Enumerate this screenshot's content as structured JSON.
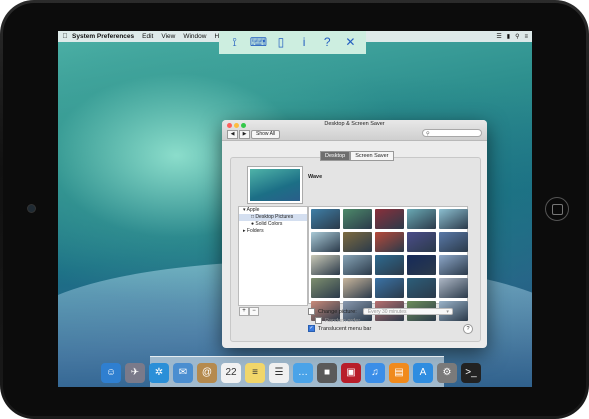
{
  "menubar": {
    "apple_symbol": "",
    "app_name": "System Preferences",
    "items": [
      "Edit",
      "View",
      "Window",
      "Help"
    ]
  },
  "toolbar": {
    "icons": [
      {
        "name": "pin-icon",
        "glyph": "⟟"
      },
      {
        "name": "keyboard-icon",
        "glyph": "⌨"
      },
      {
        "name": "mouse-icon",
        "glyph": "▯"
      },
      {
        "name": "info-icon",
        "glyph": "i"
      },
      {
        "name": "help-icon",
        "glyph": "?"
      },
      {
        "name": "close-icon",
        "glyph": "✕"
      }
    ]
  },
  "window": {
    "title": "Desktop & Screen Saver",
    "nav_back": "◀",
    "nav_forward": "▶",
    "show_all": "Show All",
    "search_placeholder": "",
    "tabs": [
      "Desktop",
      "Screen Saver"
    ],
    "active_tab": "Desktop",
    "current_picture_name": "Wave",
    "sidebar": {
      "group": "Apple",
      "items": [
        "Desktop Pictures",
        "Solid Colors"
      ],
      "selected": "Desktop Pictures",
      "folders": "Folders"
    },
    "add_label": "+",
    "remove_label": "−",
    "change_picture_label": "Change picture:",
    "change_picture_interval": "Every 30 minutes",
    "random_order_label": "Random order",
    "translucent_label": "Translucent menu bar",
    "help_label": "?"
  },
  "thumbnails": [
    "#3f7fa7",
    "#4d8a6a",
    "#8a2f3a",
    "#6aa9b4",
    "#8cbfd0",
    "#a9c9d6",
    "#7d6b40",
    "#b64a3a",
    "#4b4d8a",
    "#5a79a8",
    "#c9c9b7",
    "#87a4b6",
    "#2e6a8f",
    "#162a5a",
    "#8da7c8",
    "#7e8f6f",
    "#c9b69c",
    "#3b73a6",
    "#2c5e7a",
    "#aeb8c6",
    "#c98a7a",
    "#8a9ab0",
    "#b86f6f",
    "#6c8d5a",
    "#9ab3c9"
  ],
  "dock": {
    "icons": [
      {
        "name": "finder-icon",
        "color": "#2f7fd0",
        "glyph": "☺"
      },
      {
        "name": "launchpad-icon",
        "color": "#7a7a8a",
        "glyph": "✈"
      },
      {
        "name": "safari-icon",
        "color": "#2a8fd8",
        "glyph": "✲"
      },
      {
        "name": "mail-icon",
        "color": "#4b8ed0",
        "glyph": "✉"
      },
      {
        "name": "contacts-icon",
        "color": "#b58a4e",
        "glyph": "@"
      },
      {
        "name": "calendar-icon",
        "color": "#f2f2f2",
        "glyph": "22"
      },
      {
        "name": "notes-icon",
        "color": "#f1d66a",
        "glyph": "≡"
      },
      {
        "name": "reminders-icon",
        "color": "#f0f0f0",
        "glyph": "☰"
      },
      {
        "name": "messages-icon",
        "color": "#4aa3e8",
        "glyph": "…"
      },
      {
        "name": "facetime-icon",
        "color": "#5a5a5a",
        "glyph": "■"
      },
      {
        "name": "photo-booth-icon",
        "color": "#b81e2a",
        "glyph": "▣"
      },
      {
        "name": "itunes-icon",
        "color": "#3b8ee8",
        "glyph": "♫"
      },
      {
        "name": "ibooks-icon",
        "color": "#f08a1c",
        "glyph": "▤"
      },
      {
        "name": "app-store-icon",
        "color": "#2f8de0",
        "glyph": "A"
      },
      {
        "name": "system-preferences-icon",
        "color": "#7a7a7a",
        "glyph": "⚙"
      },
      {
        "name": "terminal-icon",
        "color": "#222222",
        "glyph": ">_"
      }
    ]
  }
}
